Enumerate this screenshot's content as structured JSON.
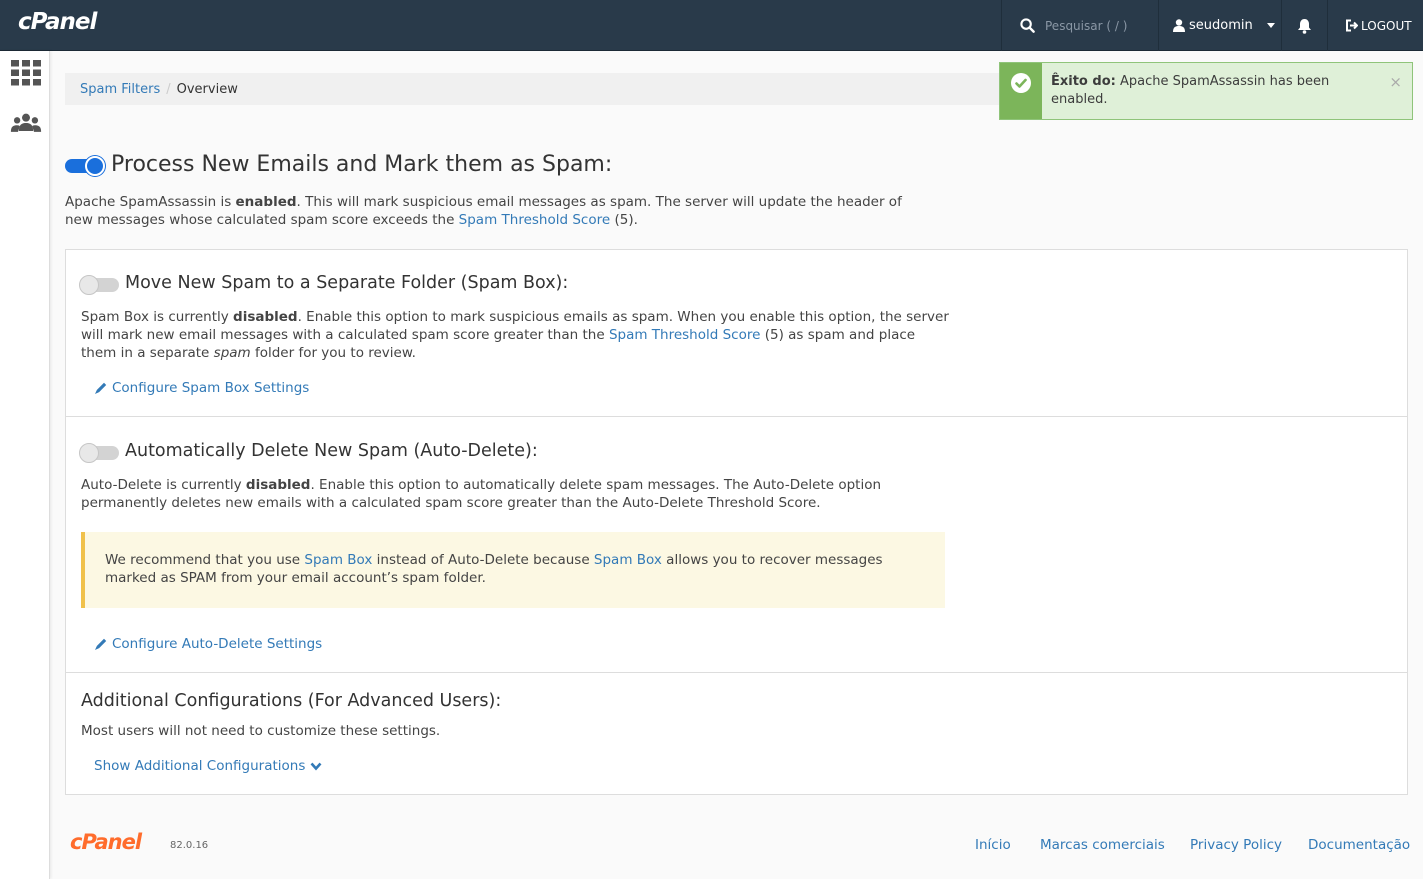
{
  "app": {
    "logo": "cPanel"
  },
  "topbar": {
    "search_placeholder": "Pesquisar ( / )",
    "username": "seudomin",
    "logout_label": "LOGOUT"
  },
  "breadcrumb": {
    "parent": "Spam Filters",
    "separator": "/",
    "current": "Overview"
  },
  "alert": {
    "prefix": "Êxito do:",
    "message": "Apache SpamAssassin has been enabled.",
    "close": "×",
    "status_color": "#7cb55a"
  },
  "process": {
    "toggle_on": true,
    "title": "Process New Emails and Mark them as Spam:",
    "text_1": "Apache SpamAssassin is ",
    "text_bold": "enabled",
    "text_2": ". This will mark suspicious email messages as spam. The server will update the header of new messages whose calculated spam score exceeds the ",
    "link": "Spam Threshold Score",
    "text_3": " (5)."
  },
  "spam_box": {
    "toggle_on": false,
    "title": "Move New Spam to a Separate Folder (Spam Box):",
    "text_1": "Spam Box is currently ",
    "text_bold": "disabled",
    "text_2": ". Enable this option to mark suspicious emails as spam. When you enable this option, the server will mark new email messages with a calculated spam score greater than the ",
    "link": "Spam Threshold Score",
    "text_3": " (5) as spam and place them in a separate ",
    "text_italic": "spam",
    "text_4": " folder for you to review.",
    "configure_link": "Configure Spam Box Settings"
  },
  "auto_delete": {
    "toggle_on": false,
    "title": "Automatically Delete New Spam (Auto-Delete):",
    "text_1": "Auto-Delete is currently ",
    "text_bold": "disabled",
    "text_2": ". Enable this option to automatically delete spam messages. The Auto-Delete option permanently deletes new emails with a calculated spam score greater than the Auto-Delete Threshold Score.",
    "warning_1": "We recommend that you use ",
    "warning_link_1": "Spam Box",
    "warning_2": " instead of Auto-Delete because ",
    "warning_link_2": "Spam Box",
    "warning_3": " allows you to recover messages marked as SPAM from your email account’s spam folder.",
    "configure_link": "Configure Auto-Delete Settings"
  },
  "additional": {
    "title": "Additional Configurations (For Advanced Users):",
    "text": "Most users will not need to customize these settings.",
    "toggle_link": "Show Additional Configurations"
  },
  "footer": {
    "logo": "cPanel",
    "version": "82.0.16",
    "links": [
      "Início",
      "Marcas comerciais",
      "Privacy Policy",
      "Documentação"
    ]
  },
  "colors": {
    "topbar": "#293a4a",
    "accent": "#337ab7",
    "toggle_on": "#1a6fdc",
    "brand_orange": "#ff6c2c"
  }
}
